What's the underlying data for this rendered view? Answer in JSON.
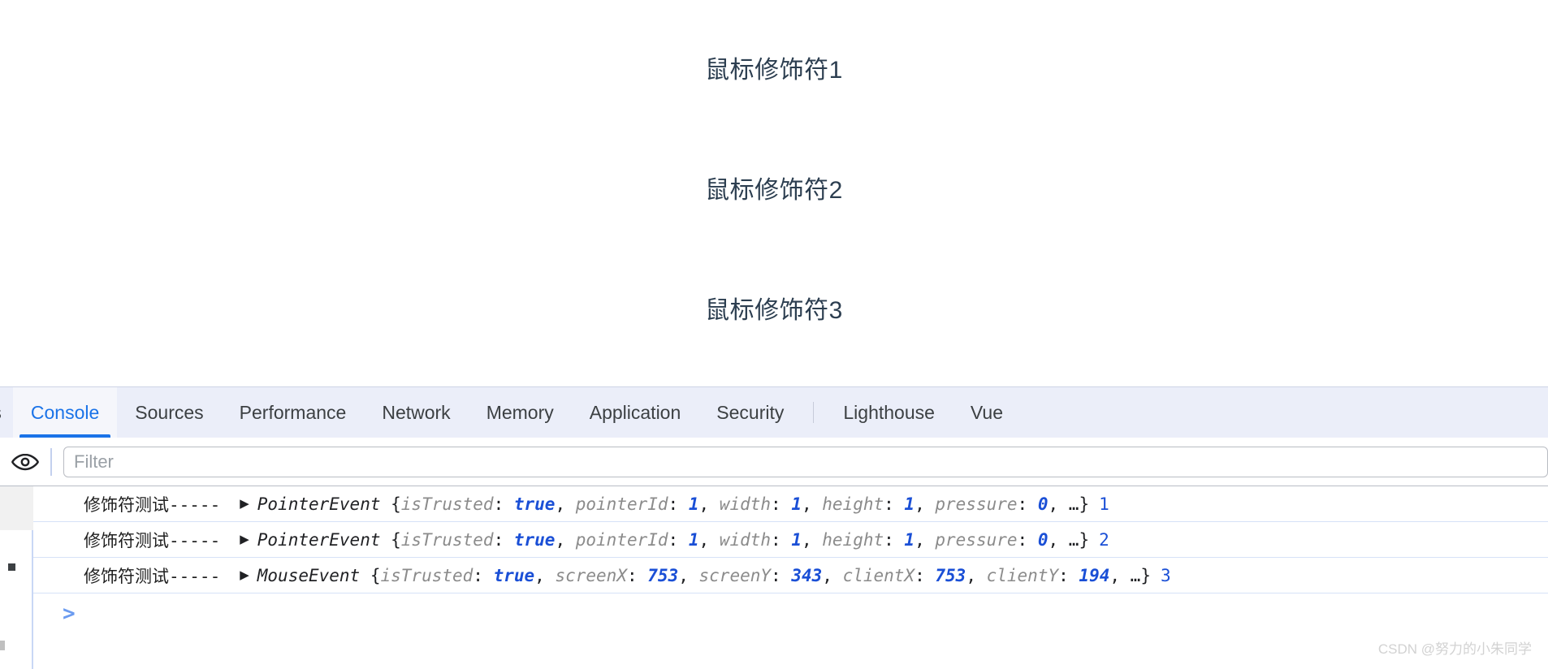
{
  "page": {
    "lines": [
      "鼠标修饰符1",
      "鼠标修饰符2",
      "鼠标修饰符3"
    ],
    "text_color": "#2c3e50"
  },
  "devtools": {
    "tabs": [
      {
        "label": "ts",
        "active": false,
        "clipped": true
      },
      {
        "label": "Console",
        "active": true,
        "clipped": false
      },
      {
        "label": "Sources",
        "active": false,
        "clipped": false
      },
      {
        "label": "Performance",
        "active": false,
        "clipped": false
      },
      {
        "label": "Network",
        "active": false,
        "clipped": false
      },
      {
        "label": "Memory",
        "active": false,
        "clipped": false
      },
      {
        "label": "Application",
        "active": false,
        "clipped": false
      },
      {
        "label": "Security",
        "active": false,
        "clipped": false
      },
      {
        "label": "Lighthouse",
        "active": false,
        "clipped": false
      },
      {
        "label": "Vue",
        "active": false,
        "clipped": false
      }
    ],
    "active_tab_color": "#1a73e8",
    "toolbar": {
      "eye_icon": "eye-icon",
      "filter_placeholder": "Filter",
      "filter_value": ""
    },
    "prompt": ">",
    "logs": [
      {
        "label": "修饰符测试-----",
        "arrow": "▶",
        "ctor": "PointerEvent",
        "props": [
          {
            "key": "isTrusted",
            "value": "true",
            "type": "bool"
          },
          {
            "key": "pointerId",
            "value": "1",
            "type": "num"
          },
          {
            "key": "width",
            "value": "1",
            "type": "num"
          },
          {
            "key": "height",
            "value": "1",
            "type": "num"
          },
          {
            "key": "pressure",
            "value": "0",
            "type": "num"
          }
        ],
        "ellipsis": "…",
        "trailer": "1"
      },
      {
        "label": "修饰符测试-----",
        "arrow": "▶",
        "ctor": "PointerEvent",
        "props": [
          {
            "key": "isTrusted",
            "value": "true",
            "type": "bool"
          },
          {
            "key": "pointerId",
            "value": "1",
            "type": "num"
          },
          {
            "key": "width",
            "value": "1",
            "type": "num"
          },
          {
            "key": "height",
            "value": "1",
            "type": "num"
          },
          {
            "key": "pressure",
            "value": "0",
            "type": "num"
          }
        ],
        "ellipsis": "…",
        "trailer": "2"
      },
      {
        "label": "修饰符测试-----",
        "arrow": "▶",
        "ctor": "MouseEvent",
        "props": [
          {
            "key": "isTrusted",
            "value": "true",
            "type": "bool"
          },
          {
            "key": "screenX",
            "value": "753",
            "type": "num"
          },
          {
            "key": "screenY",
            "value": "343",
            "type": "num"
          },
          {
            "key": "clientX",
            "value": "753",
            "type": "num"
          },
          {
            "key": "clientY",
            "value": "194",
            "type": "num"
          }
        ],
        "ellipsis": "…",
        "trailer": "3"
      }
    ]
  },
  "watermark": "CSDN @努力的小朱同学"
}
